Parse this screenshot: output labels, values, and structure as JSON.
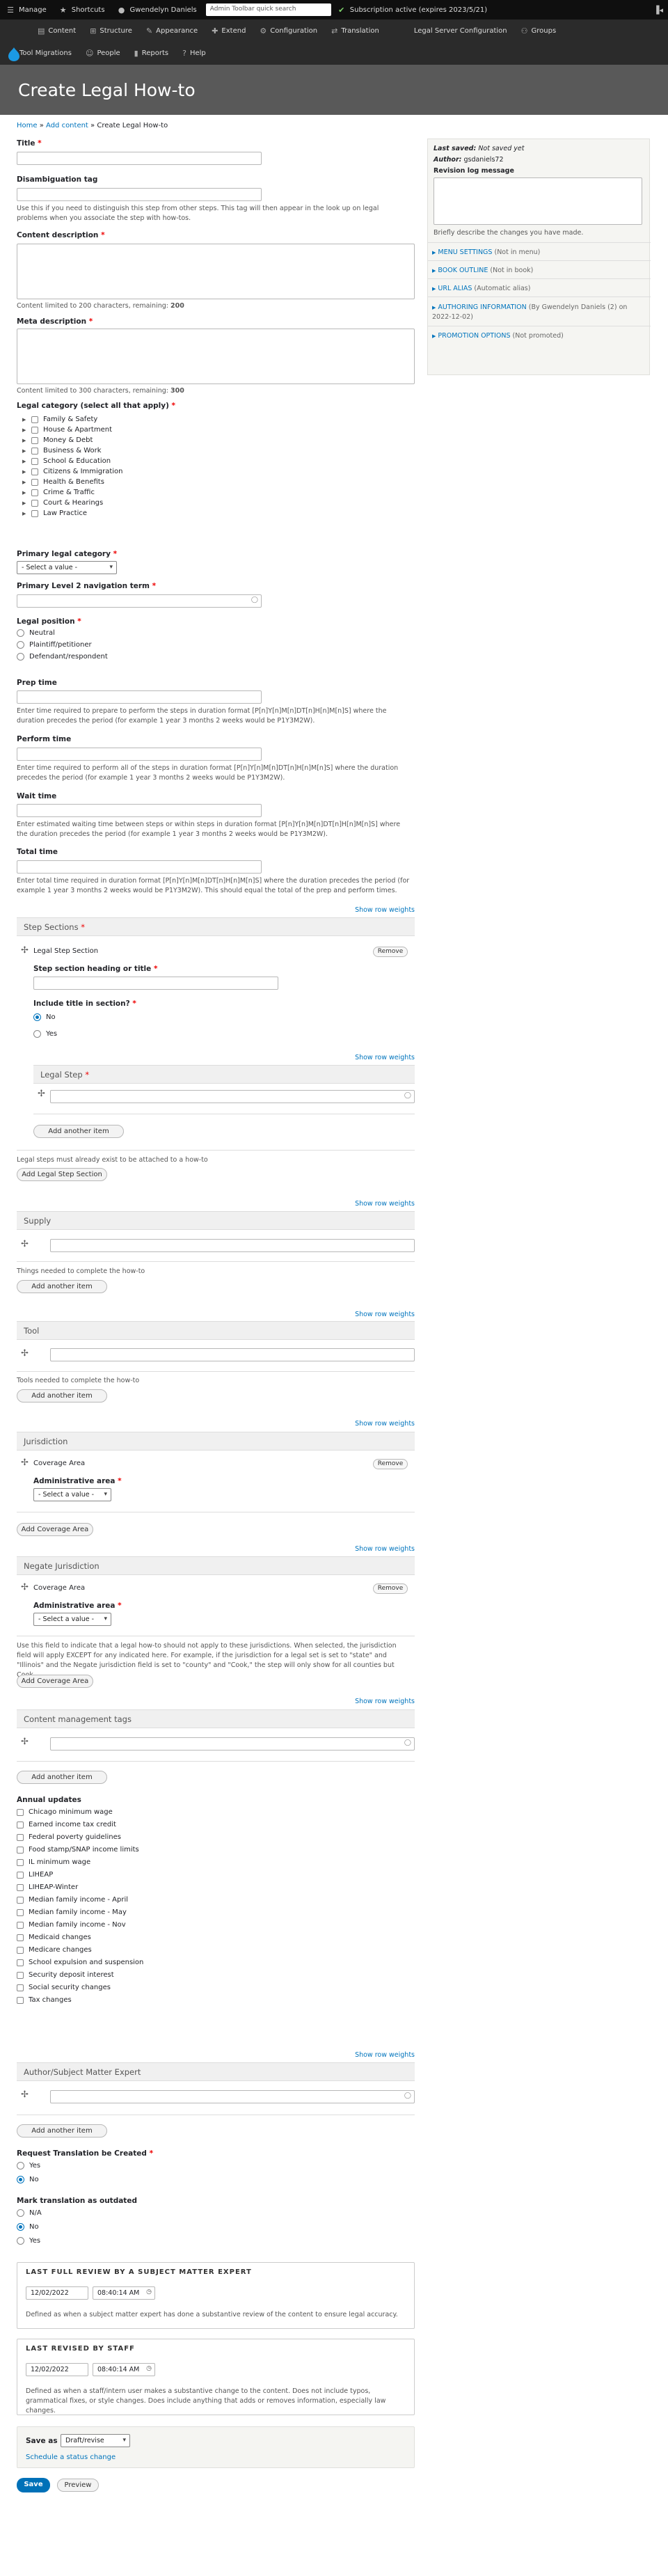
{
  "toolbar": {
    "manage": "Manage",
    "shortcuts": "Shortcuts",
    "user": "Gwendelyn Daniels",
    "search_placeholder": "Admin Toolbar quick search",
    "subscription": "Subscription active (expires 2023/5/21)"
  },
  "menu": {
    "content": "Content",
    "structure": "Structure",
    "appearance": "Appearance",
    "extend": "Extend",
    "configuration": "Configuration",
    "translation": "Translation",
    "lsc": "Legal Server Configuration",
    "groups": "Groups",
    "migrations": "Tool Migrations",
    "people": "People",
    "reports": "Reports",
    "help": "Help"
  },
  "page": {
    "title": "Create Legal How-to"
  },
  "breadcrumb": {
    "home": "Home",
    "sep1": "»",
    "add": "Add content",
    "sep2": "»",
    "current": "Create Legal How-to"
  },
  "fields": {
    "title": {
      "label": "Title",
      "req": "*"
    },
    "disamb": {
      "label": "Disambiguation tag",
      "help": "Use this if you need to distinguish this step from other steps. This tag will then appear in the look up on legal problems when you associate the step with how-tos."
    },
    "content_desc": {
      "label": "Content description",
      "req": "*",
      "help": "Content limited to 200 characters, remaining: ",
      "remaining": "200"
    },
    "meta_desc": {
      "label": "Meta description",
      "req": "*",
      "help": "Content limited to 300 characters, remaining: ",
      "remaining": "300"
    },
    "legal_cat": {
      "label": "Legal category (select all that apply)",
      "req": "*",
      "items": [
        "Family & Safety",
        "House & Apartment",
        "Money & Debt",
        "Business & Work",
        "School & Education",
        "Citizens & Immigration",
        "Health & Benefits",
        "Crime & Traffic",
        "Court & Hearings",
        "Law Practice"
      ]
    },
    "primary_cat": {
      "label": "Primary legal category",
      "req": "*",
      "value": "- Select a value -"
    },
    "primary_nav": {
      "label": "Primary Level 2 navigation term",
      "req": "*"
    },
    "legal_pos": {
      "label": "Legal position",
      "req": "*",
      "options": [
        "Neutral",
        "Plaintiff/petitioner",
        "Defendant/respondent"
      ]
    },
    "prep": {
      "label": "Prep time",
      "help": "Enter time required to prepare to perform the steps in duration format [P[n]Y[n]M[n]DT[n]H[n]M[n]S] where the duration precedes the period (for example 1 year 3 months 2 weeks would be P1Y3M2W)."
    },
    "perform": {
      "label": "Perform time",
      "help": "Enter time required to perform all of the steps in duration format [P[n]Y[n]M[n]DT[n]H[n]M[n]S] where the duration precedes the period (for example 1 year 3 months 2 weeks would be P1Y3M2W)."
    },
    "wait": {
      "label": "Wait time",
      "help": "Enter estimated waiting time between steps or within steps in duration format [P[n]Y[n]M[n]DT[n]H[n]M[n]S] where the duration precedes the period (for example 1 year 3 months 2 weeks would be P1Y3M2W)."
    },
    "total": {
      "label": "Total time",
      "help": "Enter total time required in duration format [P[n]Y[n]M[n]DT[n]H[n]M[n]S] where the duration precedes the period (for example 1 year 3 months 2 weeks would be P1Y3M2W). This should equal the total of the prep and perform times."
    }
  },
  "common": {
    "show_row_weights": "Show row weights",
    "add_another": "Add another item",
    "remove": "Remove",
    "req": "*"
  },
  "steps": {
    "title": "Step Sections",
    "item": "Legal Step Section",
    "heading_label": "Step section heading or title",
    "include_label": "Include title in section?",
    "yes": "Yes",
    "no": "No",
    "legal_step": "Legal Step",
    "note": "Legal steps must already exist to be attached to a how-to",
    "add_section": "Add Legal Step Section"
  },
  "supply": {
    "title": "Supply",
    "help": "Things needed to complete the how-to"
  },
  "tool": {
    "title": "Tool",
    "help": "Tools needed to complete the how-to"
  },
  "jurisdiction": {
    "title": "Jurisdiction",
    "item": "Coverage Area",
    "admin": "Administrative area",
    "value": "- Select a value -",
    "add": "Add Coverage Area"
  },
  "negate": {
    "title": "Negate Jurisdiction",
    "item": "Coverage Area",
    "admin": "Administrative area",
    "value": "- Select a value -",
    "help": "Use this field to indicate that a legal how-to should not apply to these jurisdictions. When selected, the jurisdiction field will apply EXCEPT for any indicated here. For example, if the jurisdiction for a legal set is set to \"state\" and \"Illinois\" and the Negate jurisdiction field is set to \"county\" and \"Cook,\" the step will only show for all counties but Cook.",
    "add": "Add Coverage Area"
  },
  "tags": {
    "title": "Content management tags"
  },
  "annual": {
    "label": "Annual updates",
    "items": [
      "Chicago minimum wage",
      "Earned income tax credit",
      "Federal poverty guidelines",
      "Food stamp/SNAP income limits",
      "IL minimum wage",
      "LIHEAP",
      "LIHEAP-Winter",
      "Median family income - April",
      "Median family income - May",
      "Median family income - Nov",
      "Medicaid changes",
      "Medicare changes",
      "School expulsion and suspension",
      "Security deposit interest",
      "Social security changes",
      "Tax changes"
    ]
  },
  "sme": {
    "title": "Author/Subject Matter Expert"
  },
  "translation": {
    "label": "Request Translation be Created",
    "req": "*",
    "yes": "Yes",
    "no": "No"
  },
  "outdated": {
    "label": "Mark translation as outdated",
    "na": "N/A",
    "no": "No",
    "yes": "Yes"
  },
  "review": {
    "legend": "LAST FULL REVIEW BY A SUBJECT MATTER EXPERT",
    "date": "12/02/2022",
    "time": "08:40:14 AM",
    "help": "Defined as when a subject matter expert has done a substantive review of the content to ensure legal accuracy."
  },
  "revised": {
    "legend": "LAST REVISED BY STAFF",
    "date": "12/02/2022",
    "time": "08:40:14 AM",
    "help": "Defined as when a staff/intern user makes a substantive change to the content. Does not include typos, grammatical fixes, or style changes. Does include anything that adds or removes information, especially law changes."
  },
  "save": {
    "label": "Save as",
    "value": "Draft/revise",
    "schedule": "Schedule a status change",
    "save": "Save",
    "preview": "Preview"
  },
  "sidebar": {
    "last_saved_label": "Last saved:",
    "last_saved": "Not saved yet",
    "author_label": "Author:",
    "author": "gsdaniels72",
    "revlog": "Revision log message",
    "revhelp": "Briefly describe the changes you have made.",
    "items": [
      {
        "t": "MENU SETTINGS",
        "s": "(Not in menu)"
      },
      {
        "t": "BOOK OUTLINE",
        "s": "(Not in book)"
      },
      {
        "t": "URL ALIAS",
        "s": "(Automatic alias)"
      },
      {
        "t": "AUTHORING INFORMATION",
        "s": "(By Gwendelyn Daniels (2) on 2022-12-02)"
      },
      {
        "t": "PROMOTION OPTIONS",
        "s": "(Not promoted)"
      }
    ]
  },
  "colors": {
    "toolbar": "#0f0f0f",
    "menu": "#2b2b2b",
    "header": "#595959",
    "link": "#0074bd",
    "primary": "#0071b8"
  }
}
